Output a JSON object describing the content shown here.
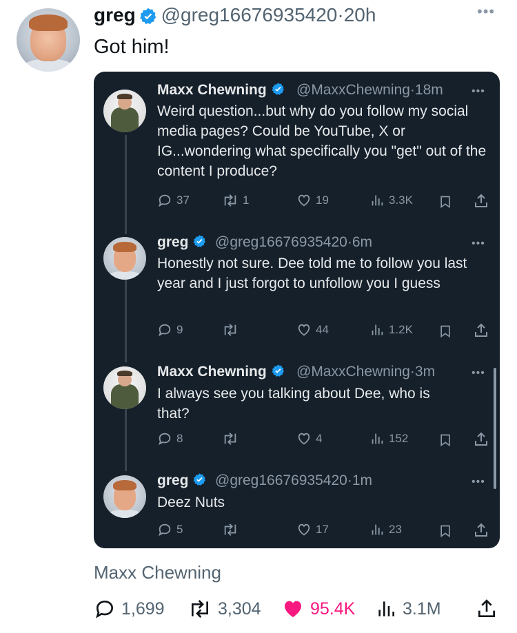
{
  "tweet": {
    "author_name": "greg",
    "author_handle": "@greg16676935420",
    "time": "20h",
    "text": "Got him!",
    "footer_label": "Maxx Chewning",
    "stats": {
      "replies": "1,699",
      "retweets": "3,304",
      "likes": "95.4K",
      "views": "3.1M"
    }
  },
  "thread": [
    {
      "name": "Maxx Chewning",
      "handle": "@MaxxChewning",
      "time": "18m",
      "text": "Weird question...but why do you follow my social media pages? Could be YouTube, X or IG...wondering what specifically you \"get\" out of the content I produce?",
      "replies": "37",
      "retweets": "1",
      "likes": "19",
      "views": "3.3K"
    },
    {
      "name": "greg",
      "handle": "@greg16676935420",
      "time": "6m",
      "text": "Honestly not sure. Dee told me to follow you last year and I just forgot to unfollow you I guess",
      "replies": "9",
      "retweets": "",
      "likes": "44",
      "views": "1.2K"
    },
    {
      "name": "Maxx Chewning",
      "handle": "@MaxxChewning",
      "time": "3m",
      "text": "I always see you talking about Dee, who is that?",
      "replies": "8",
      "retweets": "",
      "likes": "4",
      "views": "152"
    },
    {
      "name": "greg",
      "handle": "@greg16676935420",
      "time": "1m",
      "text": "Deez Nuts",
      "replies": "5",
      "retweets": "",
      "likes": "17",
      "views": "23"
    }
  ],
  "dot": "·",
  "colors": {
    "verified": "#1d9bf0",
    "like_pink": "#f91880",
    "card_bg": "#15202b"
  }
}
